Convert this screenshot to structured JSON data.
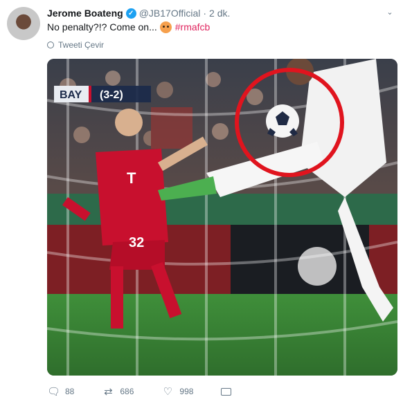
{
  "tweet": {
    "author_name": "Jerome Boateng",
    "handle": "@JB17Official",
    "dot": "·",
    "time": "2 dk.",
    "text_before": "No penalty?!? Come on...",
    "hashtag": "#rmafcb",
    "translate_label": "Tweeti Çevir",
    "icons": {
      "verified": "verified-badge-icon",
      "caret": "chevron-down-icon",
      "translate": "globe-icon",
      "emoji": "angry-face-emoji"
    }
  },
  "media": {
    "scoreboard_team": "BAY",
    "scoreboard_score": "(3-2)",
    "player_number": "32",
    "highlight_color": "#e0141e"
  },
  "actions": {
    "replies": "88",
    "retweets": "686",
    "likes": "998",
    "icons": [
      "reply-icon",
      "retweet-icon",
      "like-icon",
      "direct-message-icon"
    ]
  },
  "colors": {
    "hashtag": "#e0245e",
    "verified": "#1da1f2",
    "muted": "#657786"
  }
}
